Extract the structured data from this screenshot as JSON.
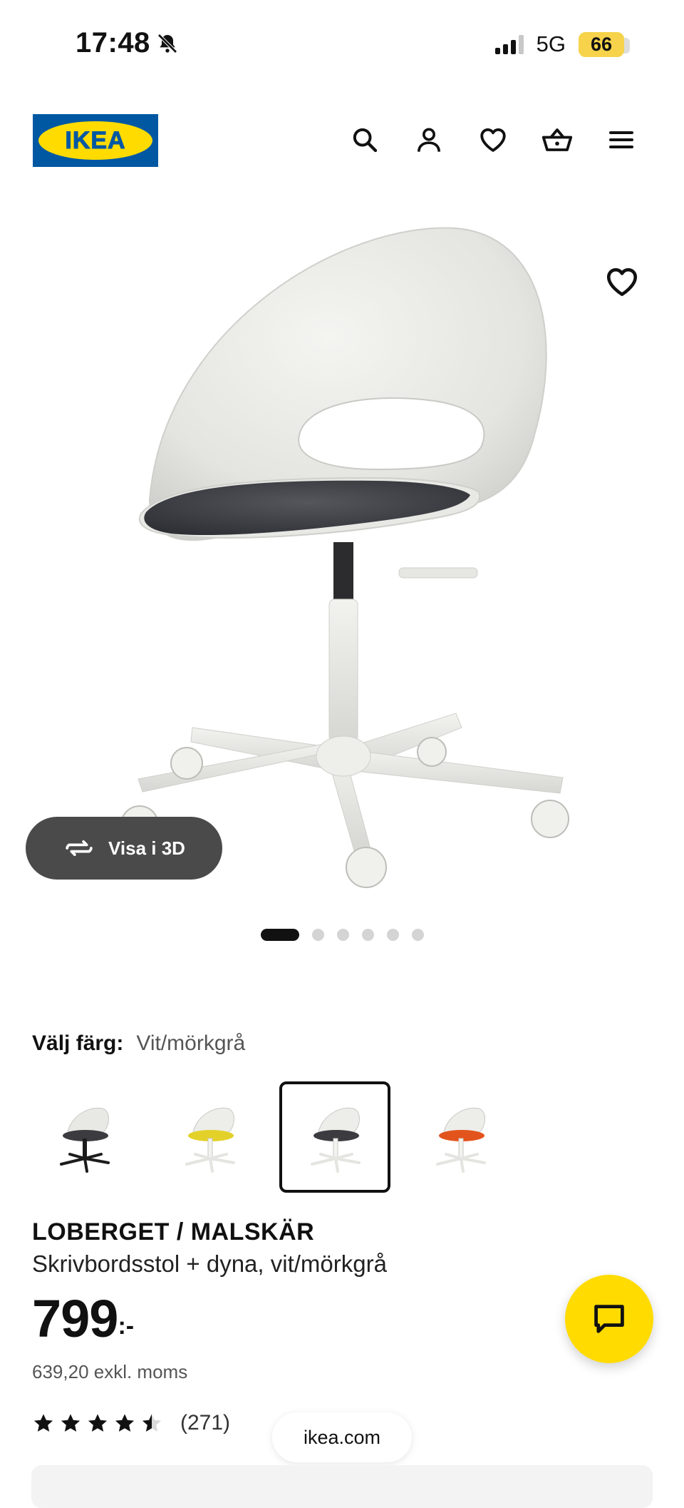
{
  "status_bar": {
    "time": "17:48",
    "network": "5G",
    "battery": "66",
    "icons": [
      "bell-muted-icon",
      "signal-icon",
      "battery-icon"
    ]
  },
  "header": {
    "logo_text": "IKEA",
    "icons": [
      "search-icon",
      "account-icon",
      "heart-icon",
      "basket-icon",
      "menu-icon"
    ],
    "colors": {
      "brand_blue": "#0058a3",
      "brand_yellow": "#ffdb00"
    }
  },
  "gallery": {
    "view_3d_label": "Visa i 3D",
    "image_count": 6,
    "active_index": 0
  },
  "color_picker": {
    "label": "Välj färg:",
    "selected_value": "Vit/mörkgrå",
    "options": [
      {
        "id": "black-base",
        "seat": "#3b3b40",
        "base": "#1c1c1c"
      },
      {
        "id": "yellow",
        "seat": "#e3d12a",
        "base": "#ffffff"
      },
      {
        "id": "white-darkgray",
        "seat": "#3b3b40",
        "base": "#ffffff",
        "selected": true
      },
      {
        "id": "orange",
        "seat": "#e2541c",
        "base": "#ffffff"
      }
    ]
  },
  "product": {
    "name": "LOBERGET / MALSKÄR",
    "description": "Skrivbordsstol + dyna, vit/mörkgrå",
    "price": "799",
    "price_suffix": ":-",
    "price_ex_vat": "639,20 exkl. moms",
    "rating": 4.5,
    "rating_count": "(271)"
  },
  "browser": {
    "url": "ikea.com"
  }
}
